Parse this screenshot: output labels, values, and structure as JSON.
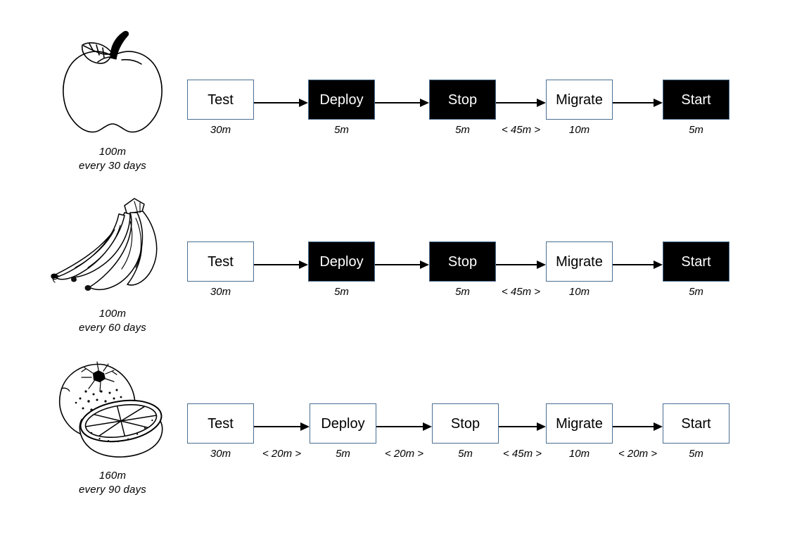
{
  "diagram": {
    "node_box_width": 95,
    "node_box_height": 57,
    "colors": {
      "box_border": "#4a6e91",
      "box_fill_white": "#ffffff",
      "box_fill_black": "#000000",
      "text_on_white": "#000000",
      "text_on_black": "#ffffff",
      "arrow": "#000000",
      "background": "#ffffff"
    },
    "rows": [
      {
        "id": "row-apple",
        "fruit": {
          "icon": "apple-icon",
          "name": "apple",
          "caption_line1": "100m",
          "caption_line2": "every 30 days"
        },
        "steps": [
          {
            "label": "Test",
            "style": "white",
            "duration": "30m"
          },
          {
            "label": "Deploy",
            "style": "black",
            "duration": "5m"
          },
          {
            "label": "Stop",
            "style": "black",
            "duration": "5m"
          },
          {
            "label": "Migrate",
            "style": "white",
            "duration": "10m"
          },
          {
            "label": "Start",
            "style": "black",
            "duration": "5m"
          }
        ],
        "gaps": [
          "",
          "",
          "< 45m >",
          ""
        ]
      },
      {
        "id": "row-banana",
        "fruit": {
          "icon": "banana-icon",
          "name": "bananas",
          "caption_line1": "100m",
          "caption_line2": "every 60 days"
        },
        "steps": [
          {
            "label": "Test",
            "style": "white",
            "duration": "30m"
          },
          {
            "label": "Deploy",
            "style": "black",
            "duration": "5m"
          },
          {
            "label": "Stop",
            "style": "black",
            "duration": "5m"
          },
          {
            "label": "Migrate",
            "style": "white",
            "duration": "10m"
          },
          {
            "label": "Start",
            "style": "black",
            "duration": "5m"
          }
        ],
        "gaps": [
          "",
          "",
          "< 45m >",
          ""
        ]
      },
      {
        "id": "row-orange",
        "fruit": {
          "icon": "orange-icon",
          "name": "orange",
          "caption_line1": "160m",
          "caption_line2": "every 90 days"
        },
        "steps": [
          {
            "label": "Test",
            "style": "white",
            "duration": "30m"
          },
          {
            "label": "Deploy",
            "style": "white",
            "duration": "5m"
          },
          {
            "label": "Stop",
            "style": "white",
            "duration": "5m"
          },
          {
            "label": "Migrate",
            "style": "white",
            "duration": "10m"
          },
          {
            "label": "Start",
            "style": "white",
            "duration": "5m"
          }
        ],
        "gaps": [
          "< 20m >",
          "< 20m >",
          "< 45m >",
          "< 20m >"
        ]
      }
    ]
  }
}
